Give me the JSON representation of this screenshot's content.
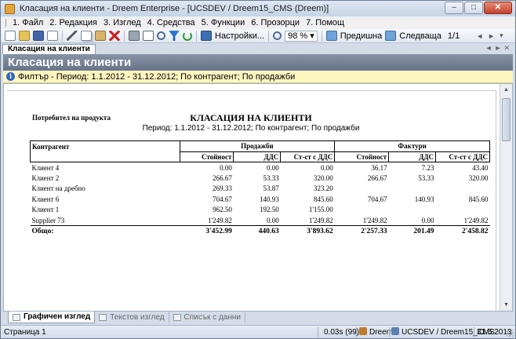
{
  "window": {
    "title": "Класация на клиенти - Dreem Enterprise - [UCSDEV / Dreem15_CMS (Dreem)]",
    "controls": {
      "minimize": "–",
      "maximize": "□",
      "close": "✕"
    }
  },
  "menu": {
    "items": [
      {
        "label": "1. Файл"
      },
      {
        "label": "2. Редакция"
      },
      {
        "label": "3. Изглед"
      },
      {
        "label": "4. Средства"
      },
      {
        "label": "5. Функции"
      },
      {
        "label": "6. Прозорци"
      },
      {
        "label": "7. Помощ"
      }
    ]
  },
  "toolbar": {
    "settings_label": "Настройки...",
    "zoom_value": "98 %",
    "prev_label": "Предишна",
    "next_label": "Следваща",
    "page_value": "1/1",
    "icons": [
      "new-icon",
      "open-icon",
      "save-icon",
      "check-icon",
      "cut-icon",
      "copy-icon",
      "paste-icon",
      "delete-icon",
      "print-icon",
      "print-preview-icon",
      "find-icon",
      "filter-icon",
      "refresh-icon",
      "settings-icon",
      "zoom-icon",
      "previous-page-icon",
      "next-page-icon"
    ]
  },
  "doc_tab": {
    "label": "Класация на клиенти"
  },
  "header": {
    "title": "Класация на клиенти"
  },
  "filter": {
    "text": "Филтър - Период: 1.1.2012 - 31.12.2012; По контрагент; По продажби"
  },
  "report": {
    "subtitle": "Потребител на продукта",
    "title": "КЛАСАЦИЯ НА КЛИЕНТИ",
    "period": "Период: 1.1.2012 - 31.12.2012; По контрагент; По продажби",
    "col_contragent": "Контрагент",
    "group_sales": "Продажби",
    "group_invoices": "Фактури",
    "col_value": "Стойност",
    "col_vat": "ДДС",
    "col_value_vat": "Ст-ст с ДДС",
    "rows": [
      {
        "name": "Клиент 4",
        "s_value": "0.00",
        "s_vat": "0.00",
        "s_total": "0.00",
        "f_value": "36.17",
        "f_vat": "7.23",
        "f_total": "43.40"
      },
      {
        "name": "Клиент 2",
        "s_value": "266.67",
        "s_vat": "53.33",
        "s_total": "320.00",
        "f_value": "266.67",
        "f_vat": "53.33",
        "f_total": "320.00"
      },
      {
        "name": "Клиент на дребно",
        "s_value": "269.33",
        "s_vat": "53.87",
        "s_total": "323.20",
        "f_value": "",
        "f_vat": "",
        "f_total": ""
      },
      {
        "name": "Клиент 6",
        "s_value": "704.67",
        "s_vat": "140.93",
        "s_total": "845.60",
        "f_value": "704.67",
        "f_vat": "140.93",
        "f_total": "845.60"
      },
      {
        "name": "Клиент 1",
        "s_value": "962.50",
        "s_vat": "192.50",
        "s_total": "1'155.00",
        "f_value": "",
        "f_vat": "",
        "f_total": ""
      },
      {
        "name": "Supplier 73",
        "s_value": "1'249.82",
        "s_vat": "0.00",
        "s_total": "1'249.82",
        "f_value": "1'249.82",
        "f_vat": "0.00",
        "f_total": "1'249.82"
      }
    ],
    "total": {
      "label": "Общо:",
      "s_value": "3'452.99",
      "s_vat": "440.63",
      "s_total": "3'893.62",
      "f_value": "2'257.33",
      "f_vat": "201.49",
      "f_total": "2'458.82"
    }
  },
  "bottom_tabs": [
    {
      "label": "Графичен изглед"
    },
    {
      "label": "Текстов изглед"
    },
    {
      "label": "Списък с данни"
    }
  ],
  "status": {
    "page": "Страница 1",
    "time": "0.03s (99)",
    "app": "Dreem",
    "db": "UCSDEV / Dreem15_CMS",
    "date": "31.5.2013"
  }
}
